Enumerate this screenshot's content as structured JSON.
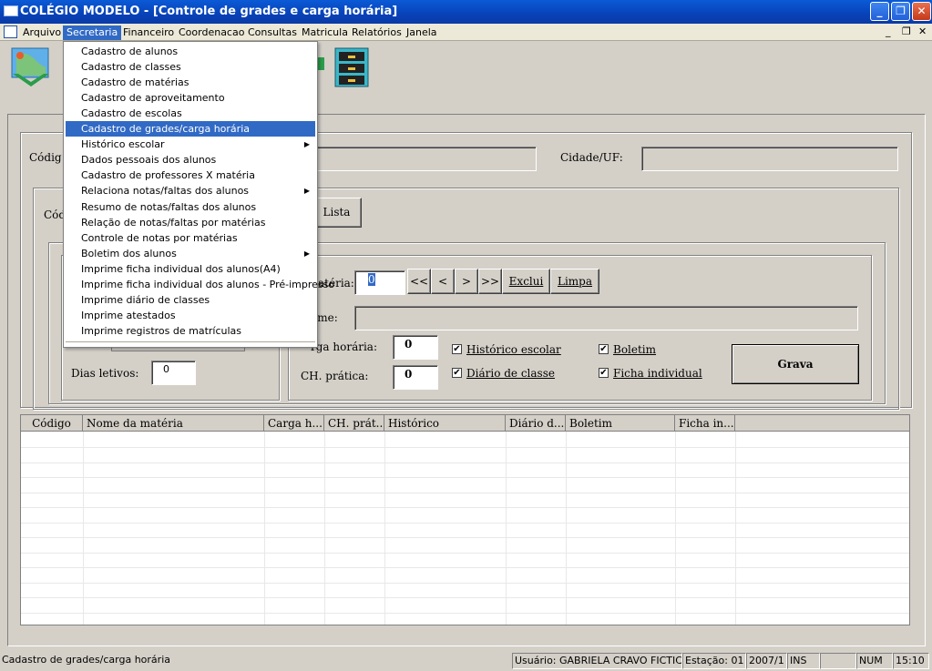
{
  "window": {
    "title": "COLÉGIO MODELO - [Controle de grades e carga horária]"
  },
  "menubar": {
    "items": [
      "Arquivo",
      "Secretaria",
      "Financeiro",
      "Coordenacao",
      "Consultas",
      "Matricula",
      "Relatórios",
      "Janela"
    ]
  },
  "dropdown": {
    "items": [
      {
        "label": "Cadastro de alunos",
        "submenu": false
      },
      {
        "label": "Cadastro de classes",
        "submenu": false
      },
      {
        "label": "Cadastro de matérias",
        "submenu": false
      },
      {
        "label": "Cadastro de aproveitamento",
        "submenu": false
      },
      {
        "label": "Cadastro de escolas",
        "submenu": false
      },
      {
        "label": "Cadastro de grades/carga horária",
        "submenu": false,
        "selected": true
      },
      {
        "label": "Histórico escolar",
        "submenu": true
      },
      {
        "label": "Dados pessoais dos alunos",
        "submenu": false
      },
      {
        "label": "Cadastro de professores X matéria",
        "submenu": false
      },
      {
        "label": "Relaciona notas/faltas dos alunos",
        "submenu": true
      },
      {
        "label": "Resumo de notas/faltas dos alunos",
        "submenu": false
      },
      {
        "label": "Relação de notas/faltas por matérias",
        "submenu": false
      },
      {
        "label": "Controle de notas por matérias",
        "submenu": false
      },
      {
        "label": "Boletim dos alunos",
        "submenu": true
      },
      {
        "label": "Imprime ficha individual dos alunos(A4)",
        "submenu": false
      },
      {
        "label": "Imprime ficha individual dos alunos - Pré-impresso",
        "submenu": false
      },
      {
        "label": "Imprime diário de classes",
        "submenu": false
      },
      {
        "label": "Imprime atestados",
        "submenu": false
      },
      {
        "label": "Imprime registros de matrículas",
        "submenu": false
      }
    ]
  },
  "form": {
    "codigo_label": "Códig",
    "cidade_label": "Cidade/UF:",
    "cod2_label": "Cód",
    "lista_btn": "Lista",
    "materia_label": "atéria:",
    "materia_value": "0",
    "nav": [
      "<<",
      "<",
      ">",
      ">>"
    ],
    "exclui_btn": "Exclui",
    "limpa_btn": "Limpa",
    "nome_label": "ome:",
    "carga_label": "rga horária:",
    "carga_value": "0",
    "chpratica_label": "CH. prática:",
    "chpratica_value": "0",
    "dias_label": "Dias letivos:",
    "dias_value": "0",
    "chk_historico": "Histórico escolar",
    "chk_diario": "Diário de classe",
    "chk_boletim": "Boletim",
    "chk_ficha": "Ficha individual",
    "grava_btn": "Grava"
  },
  "grid": {
    "columns": [
      "Código",
      "Nome da matéria",
      "Carga h...",
      "CH. prát...",
      "Histórico",
      "Diário d...",
      "Boletim",
      "Ficha in..."
    ]
  },
  "status": {
    "message": "Cadastro de grades/carga horária",
    "user": "Usuário: GABRIELA CRAVO FICTICIO",
    "station": "Estação: 01",
    "period": "2007/1",
    "ins": "INS",
    "num": "NUM",
    "time": "15:10"
  }
}
